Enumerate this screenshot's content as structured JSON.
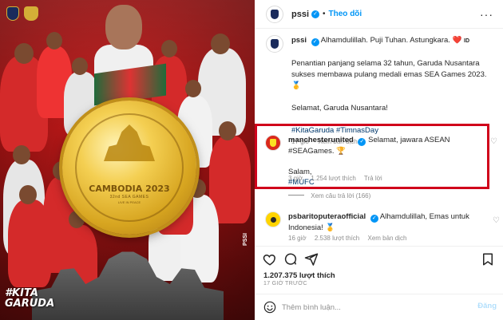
{
  "poster": {
    "medal_title": "CAMBODIA 2023",
    "medal_sub": "32nd SEA GAMES",
    "medal_sub2": "LIVE IN PEACE",
    "hashtag_art": "#KITA\nGARUDA",
    "brand": "PSSI"
  },
  "post": {
    "username": "pssi",
    "follow_label": "Theo dõi",
    "more_label": "···",
    "caption_line1": "Alhamdulillah. Puji Tuhan. Astungkara. ❤️",
    "caption_line1_suffix": "ID",
    "caption_p2": "Penantian panjang selama 32 tahun, Garuda Nusantara sukses membawa pulang medali emas SEA Games 2023. 🥇",
    "caption_p3": "Selamat, Garuda Nusantara!",
    "caption_tags": "#KitaGaruda #TimnasDay",
    "caption_meta_time": "17 giờ",
    "caption_meta_translate": "Xem bản dịch"
  },
  "comments": [
    {
      "username": "manchesterunited",
      "text": "Selamat, jawara ASEAN #SEAGames. 🏆",
      "text2": "Salam,",
      "text3": "#MUFC",
      "time": "3 giờ",
      "likes": "1.254 lượt thích",
      "reply": "Trả lời"
    },
    {
      "username": "psbaritoputeraofficial",
      "text": "Alhamdulillah, Emas untuk Indonesia! 🥇",
      "time": "16 giờ",
      "likes": "2.538 lượt thích",
      "translate": "Xem bản dịch"
    }
  ],
  "view_replies": "Xem câu trả lời (166)",
  "likes_total": "1.207.375 lượt thích",
  "post_age": "17 GIỜ TRƯỚC",
  "comment_box": {
    "placeholder": "Thêm bình luận...",
    "post_label": "Đăng"
  },
  "colors": {
    "accent": "#0095f6",
    "highlight_box": "#d0021b",
    "poster_red": "#a11313",
    "medal_gold": "#d7a520"
  }
}
